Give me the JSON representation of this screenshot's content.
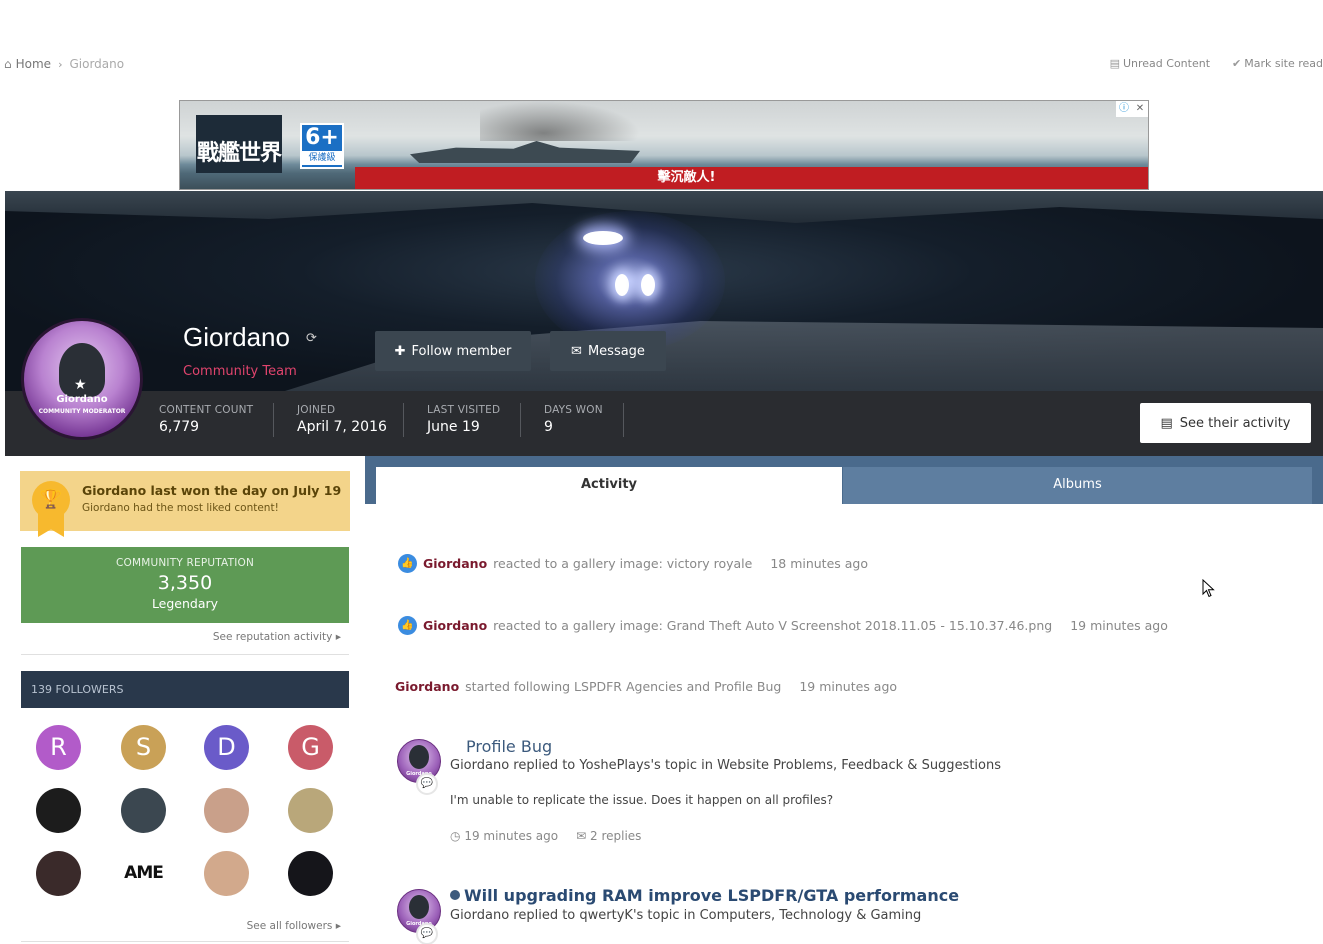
{
  "breadcrumb": {
    "home": "Home",
    "current": "Giordano"
  },
  "topnav": {
    "unread": "Unread Content",
    "mark_read": "Mark site read"
  },
  "ad": {
    "brand": "戰艦世界",
    "rating": "6+",
    "rating_label": "保護級",
    "tagline": "擊沉敵人!"
  },
  "profile": {
    "name": "Giordano",
    "role": "Community Team",
    "avatar_label1": "Giordano",
    "avatar_label2": "COMMUNITY MODERATOR",
    "follow_label": "Follow member",
    "message_label": "Message",
    "activity_button": "See their activity",
    "stats": [
      {
        "key": "CONTENT COUNT",
        "value": "6,779"
      },
      {
        "key": "JOINED",
        "value": "April 7, 2016"
      },
      {
        "key": "LAST VISITED",
        "value": "June 19"
      },
      {
        "key": "DAYS WON",
        "value": "9"
      }
    ]
  },
  "won": {
    "title": "Giordano last won the day on July 19",
    "subtitle": "Giordano had the most liked content!"
  },
  "reputation": {
    "label": "COMMUNITY REPUTATION",
    "value": "3,350",
    "rank": "Legendary",
    "link": "See reputation activity"
  },
  "followers": {
    "header": "139 FOLLOWERS",
    "link": "See all followers",
    "items": [
      {
        "letter": "R",
        "color": "#b25bc9"
      },
      {
        "letter": "S",
        "color": "#c9a157"
      },
      {
        "letter": "D",
        "color": "#6a5bc9"
      },
      {
        "letter": "G",
        "color": "#c95b69"
      },
      {
        "letter": "",
        "color": "#1c1c1c"
      },
      {
        "letter": "",
        "color": "#3b4750"
      },
      {
        "letter": "",
        "color": "#c9a08a"
      },
      {
        "letter": "",
        "color": "#b9a77a"
      },
      {
        "letter": "",
        "color": "#3a2a2a"
      },
      {
        "letter": "AME",
        "color": "#ffffff"
      },
      {
        "letter": "",
        "color": "#d2a98c"
      },
      {
        "letter": "",
        "color": "#15151a"
      }
    ]
  },
  "tabs": {
    "activity": "Activity",
    "albums": "Albums"
  },
  "stream": {
    "items": [
      {
        "user": "Giordano",
        "text": "reacted to a gallery image: victory royale",
        "time": "18 minutes ago"
      },
      {
        "user": "Giordano",
        "text": "reacted to a gallery image: Grand Theft Auto V Screenshot 2018.11.05 - 15.10.37.46.png",
        "time": "19 minutes ago"
      },
      {
        "user": "Giordano",
        "text": "started following LSPDFR Agencies and Profile Bug",
        "time": "19 minutes ago"
      }
    ],
    "posts": [
      {
        "title": "Profile Bug",
        "meta": "Giordano replied to YoshePlays's topic in Website Problems, Feedback & Suggestions",
        "body": "I'm unable to replicate the issue. Does it happen on all profiles?",
        "time": "19 minutes ago",
        "replies": "2 replies"
      },
      {
        "title": "Will upgrading RAM improve LSPDFR/GTA performance",
        "meta": "Giordano replied to qwertyK's topic in Computers, Technology & Gaming"
      }
    ]
  },
  "colors": {
    "accent": "#4a6a8c",
    "role": "#e0446d",
    "reputation": "#5e9a55",
    "won": "#f3d48a"
  }
}
